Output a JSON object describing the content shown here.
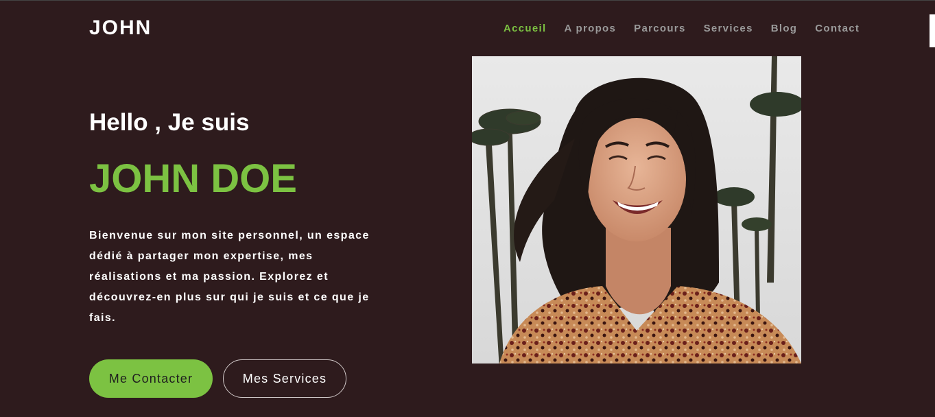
{
  "header": {
    "logo": "JOHN",
    "nav": [
      {
        "label": "Accueil",
        "active": true
      },
      {
        "label": "A propos",
        "active": false
      },
      {
        "label": "Parcours",
        "active": false
      },
      {
        "label": "Services",
        "active": false
      },
      {
        "label": "Blog",
        "active": false
      },
      {
        "label": "Contact",
        "active": false
      }
    ]
  },
  "hero": {
    "greeting": "Hello , Je suis",
    "name": "JOHN DOE",
    "intro": "Bienvenue sur mon site personnel, un espace dédié à partager mon expertise, mes réalisations et ma passion. Explorez et découvrez-en plus sur qui je suis et ce que je fais.",
    "primary_button": "Me Contacter",
    "secondary_button": "Mes Services",
    "photo": "portrait of smiling woman with palm trees"
  },
  "colors": {
    "background": "#2e1b1d",
    "accent": "#7cc242",
    "nav_inactive": "#9a9a9a",
    "text": "#ffffff"
  }
}
